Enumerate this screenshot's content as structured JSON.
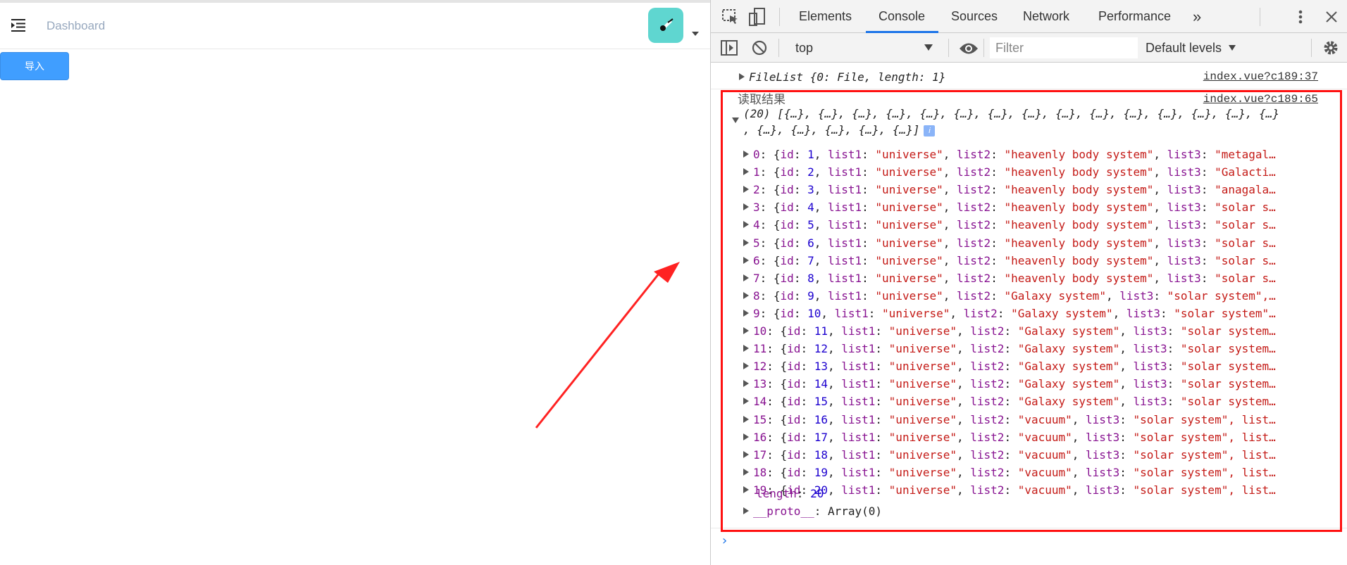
{
  "app": {
    "breadcrumb": "Dashboard",
    "import_button": "导入",
    "accent": "#409eff",
    "avatar_color": "#5fd6d0"
  },
  "devtools": {
    "tabs": [
      "Elements",
      "Console",
      "Sources",
      "Network",
      "Performance"
    ],
    "more_tabs": "»",
    "active_tab": "Console",
    "context": "top",
    "filter_placeholder": "Filter",
    "levels": "Default levels",
    "icons": [
      "inspect-icon",
      "device-toolbar-icon",
      "kebab-menu-icon",
      "close-icon",
      "sidebar-toggle-icon",
      "clear-console-icon",
      "eye-icon",
      "gear-icon"
    ]
  },
  "console": {
    "msg1": {
      "text": "FileList {0: File, length: 1}",
      "source": "index.vue?c189:37"
    },
    "msg2": {
      "label": "读取结果",
      "source": "index.vue?c189:65",
      "summary_line1": "(20) [{…}, {…}, {…}, {…}, {…}, {…}, {…}, {…}, {…}, {…}, {…}, {…}, {…}, {…}, {…}",
      "summary_line2": ", {…}, {…}, {…}, {…}, {…}]",
      "info": "i",
      "rows": [
        {
          "idx": "0",
          "id": "1",
          "list2": "\"heavenly body system\"",
          "tail": "\"metagal…"
        },
        {
          "idx": "1",
          "id": "2",
          "list2": "\"heavenly body system\"",
          "tail": "\"Galacti…"
        },
        {
          "idx": "2",
          "id": "3",
          "list2": "\"heavenly body system\"",
          "tail": "\"anagala…"
        },
        {
          "idx": "3",
          "id": "4",
          "list2": "\"heavenly body system\"",
          "tail": "\"solar s…"
        },
        {
          "idx": "4",
          "id": "5",
          "list2": "\"heavenly body system\"",
          "tail": "\"solar s…"
        },
        {
          "idx": "5",
          "id": "6",
          "list2": "\"heavenly body system\"",
          "tail": "\"solar s…"
        },
        {
          "idx": "6",
          "id": "7",
          "list2": "\"heavenly body system\"",
          "tail": "\"solar s…"
        },
        {
          "idx": "7",
          "id": "8",
          "list2": "\"heavenly body system\"",
          "tail": "\"solar s…"
        },
        {
          "idx": "8",
          "id": "9",
          "list2": "\"Galaxy system\"",
          "tail": "\"solar system\",…"
        },
        {
          "idx": "9",
          "id": "10",
          "list2": "\"Galaxy system\"",
          "tail": "\"solar system\"…"
        },
        {
          "idx": "10",
          "id": "11",
          "list2": "\"Galaxy system\"",
          "tail": "\"solar system…"
        },
        {
          "idx": "11",
          "id": "12",
          "list2": "\"Galaxy system\"",
          "tail": "\"solar system…"
        },
        {
          "idx": "12",
          "id": "13",
          "list2": "\"Galaxy system\"",
          "tail": "\"solar system…"
        },
        {
          "idx": "13",
          "id": "14",
          "list2": "\"Galaxy system\"",
          "tail": "\"solar system…"
        },
        {
          "idx": "14",
          "id": "15",
          "list2": "\"Galaxy system\"",
          "tail": "\"solar system…"
        },
        {
          "idx": "15",
          "id": "16",
          "list2": "\"vacuum\"",
          "tail": "\"solar system\", list…"
        },
        {
          "idx": "16",
          "id": "17",
          "list2": "\"vacuum\"",
          "tail": "\"solar system\", list…"
        },
        {
          "idx": "17",
          "id": "18",
          "list2": "\"vacuum\"",
          "tail": "\"solar system\", list…"
        },
        {
          "idx": "18",
          "id": "19",
          "list2": "\"vacuum\"",
          "tail": "\"solar system\", list…"
        },
        {
          "idx": "19",
          "id": "20",
          "list2": "\"vacuum\"",
          "tail": "\"solar system\", list…"
        }
      ],
      "list1_value": "\"universe\"",
      "length_key": "length",
      "length_value": "20",
      "proto_key": "__proto__",
      "proto_value": "Array(0)"
    },
    "prompt": "›"
  }
}
